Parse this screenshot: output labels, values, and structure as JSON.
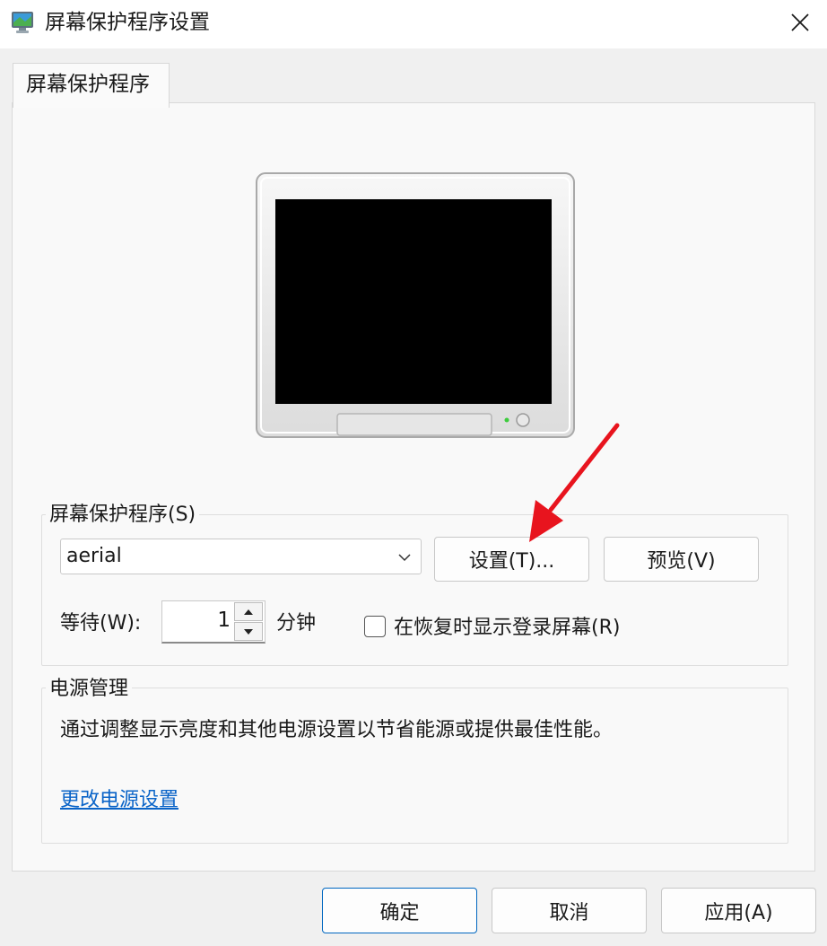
{
  "window": {
    "title": "屏幕保护程序设置",
    "icon": "screen-saver-app-icon",
    "close_icon": "close-icon"
  },
  "tabs": [
    {
      "label": "屏幕保护程序",
      "selected": true
    }
  ],
  "preview": {
    "icon": "monitor-preview-icon"
  },
  "screensaver_group": {
    "title": "屏幕保护程序(S)",
    "selected_value": "aerial",
    "settings_button": "设置(T)...",
    "preview_button": "预览(V)",
    "wait_label": "等待(W):",
    "wait_value": "1",
    "wait_unit": "分钟",
    "resume_logon_label": "在恢复时显示登录屏幕(R)",
    "resume_logon_checked": false
  },
  "power_group": {
    "title": "电源管理",
    "description": "通过调整显示亮度和其他电源设置以节省能源或提供最佳性能。",
    "link": "更改电源设置"
  },
  "footer": {
    "ok": "确定",
    "cancel": "取消",
    "apply": "应用(A)"
  },
  "colors": {
    "accent": "#0067c0",
    "link": "#0a64c8",
    "annotation_arrow": "#e8141e"
  }
}
